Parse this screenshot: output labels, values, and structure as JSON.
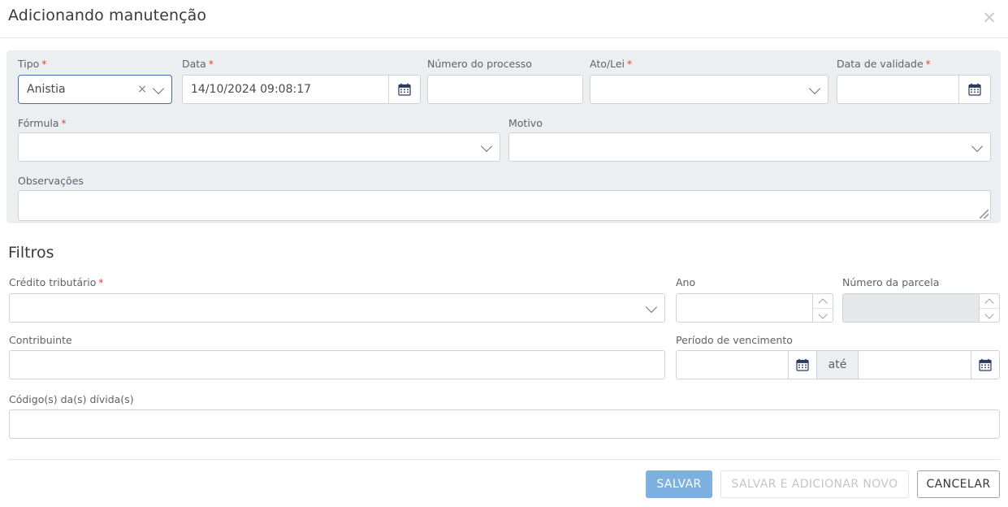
{
  "dialog": {
    "title": "Adicionando manutenção",
    "close_icon": "close-icon"
  },
  "form": {
    "tipo": {
      "label": "Tipo",
      "required": "*",
      "value": "Anistia",
      "clear_icon": "×",
      "chevron_icon": "chevron-down-icon"
    },
    "data": {
      "label": "Data",
      "required": "*",
      "value": "14/10/2024 09:08:17",
      "calendar_icon": "calendar-icon"
    },
    "numero_processo": {
      "label": "Número do processo",
      "value": ""
    },
    "ato_lei": {
      "label": "Ato/Lei",
      "required": "*",
      "value": "",
      "chevron_icon": "chevron-down-icon"
    },
    "data_validade": {
      "label": "Data de validade",
      "required": "*",
      "value": "",
      "calendar_icon": "calendar-icon"
    },
    "formula": {
      "label": "Fórmula",
      "required": "*",
      "value": "",
      "chevron_icon": "chevron-down-icon"
    },
    "motivo": {
      "label": "Motivo",
      "value": "",
      "chevron_icon": "chevron-down-icon"
    },
    "observacoes": {
      "label": "Observações",
      "value": ""
    }
  },
  "filters": {
    "section_title": "Filtros",
    "credito_tributario": {
      "label": "Crédito tributário",
      "required": "*",
      "value": "",
      "chevron_icon": "chevron-down-icon"
    },
    "ano": {
      "label": "Ano",
      "value": "",
      "stepper_up_icon": "chevron-up-icon",
      "stepper_down_icon": "chevron-down-icon"
    },
    "numero_parcela": {
      "label": "Número da parcela",
      "value": "",
      "disabled": true,
      "stepper_up_icon": "chevron-up-icon",
      "stepper_down_icon": "chevron-down-icon"
    },
    "contribuinte": {
      "label": "Contribuinte",
      "value": ""
    },
    "periodo_vencimento": {
      "label": "Período de vencimento",
      "start_value": "",
      "separator": "até",
      "end_value": "",
      "calendar_icon": "calendar-icon"
    },
    "codigos_dividas": {
      "label": "Código(s) da(s) dívida(s)",
      "value": ""
    }
  },
  "footer": {
    "save_label": "SALVAR",
    "save_and_add_label": "SALVAR E ADICIONAR NOVO",
    "cancel_label": "CANCELAR"
  },
  "colors": {
    "primary": "#7cb0e0",
    "panel_bg": "#eceff1",
    "required_red": "#e34234",
    "focus_border": "#3f72b4"
  }
}
